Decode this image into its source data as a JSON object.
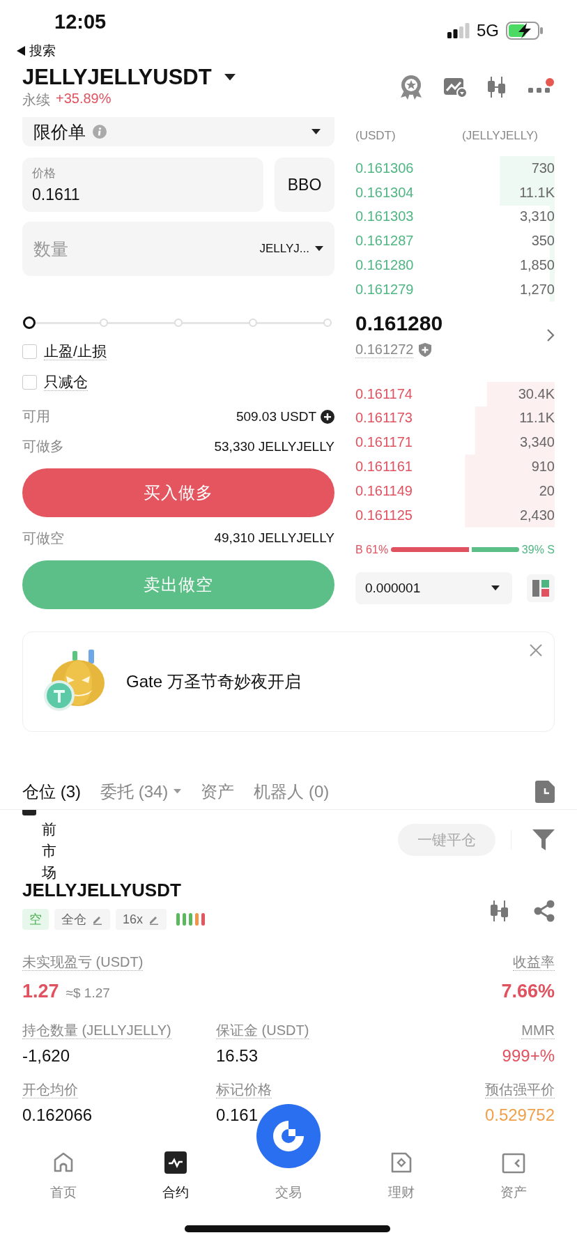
{
  "status_bar": {
    "time": "12:05",
    "network": "5G"
  },
  "back": {
    "label": "搜索"
  },
  "header": {
    "symbol": "JELLYJELLYUSDT",
    "type": "永续",
    "change": "+35.89%"
  },
  "order_form": {
    "order_type": "限价单",
    "price": {
      "label": "价格",
      "value": "0.1611"
    },
    "bbo": "BBO",
    "quantity": {
      "placeholder": "数量",
      "unit": "JELLYJ..."
    },
    "slider": {
      "level": 0
    },
    "options": [
      {
        "label": "止盈/止损",
        "checked": false
      },
      {
        "label": "只减仓",
        "checked": false
      }
    ],
    "available": {
      "label": "可用",
      "value": "509.03 USDT"
    },
    "long_max": {
      "label": "可做多",
      "value": "53,330 JELLYJELLY"
    },
    "buy_button": "买入做多",
    "short_max": {
      "label": "可做空",
      "value": "49,310 JELLYJELLY"
    },
    "sell_button": "卖出做空"
  },
  "order_book": {
    "columns": [
      "(USDT)",
      "(JELLYJELLY)"
    ],
    "asks": [
      {
        "price": "0.161306",
        "amount": "730"
      },
      {
        "price": "0.161304",
        "amount": "11.1K"
      },
      {
        "price": "0.161303",
        "amount": "3,310"
      },
      {
        "price": "0.161287",
        "amount": "350"
      },
      {
        "price": "0.161280",
        "amount": "1,850"
      },
      {
        "price": "0.161279",
        "amount": "1,270"
      }
    ],
    "last_price": "0.161280",
    "mark_price": "0.161272",
    "bids": [
      {
        "price": "0.161174",
        "amount": "30.4K"
      },
      {
        "price": "0.161173",
        "amount": "11.1K"
      },
      {
        "price": "0.161171",
        "amount": "3,340"
      },
      {
        "price": "0.161161",
        "amount": "910"
      },
      {
        "price": "0.161149",
        "amount": "20"
      },
      {
        "price": "0.161125",
        "amount": "2,430"
      }
    ],
    "ratio": {
      "buy": "B 61%",
      "sell": "39% S",
      "level": 0.61
    },
    "precision": "0.000001"
  },
  "banner": {
    "text": "Gate 万圣节奇妙夜开启"
  },
  "tabs": [
    {
      "label": "仓位 (3)",
      "selected": true,
      "dropdown": false
    },
    {
      "label": "委托 (34)",
      "selected": false,
      "dropdown": true
    },
    {
      "label": "资产",
      "selected": false,
      "dropdown": false
    },
    {
      "label": "机器人 (0)",
      "selected": false,
      "dropdown": false
    }
  ],
  "positions": {
    "filter": {
      "label": "前市场",
      "checked": true
    },
    "close_all": "一键平仓",
    "symbol": "JELLYJELLYUSDT",
    "tags": [
      {
        "label": "空",
        "kind": "side"
      },
      {
        "label": "全仓",
        "kind": "editable"
      },
      {
        "label": "16x",
        "kind": "editable"
      }
    ],
    "risk_bars": [
      {
        "color": "#5cb85c"
      },
      {
        "color": "#5cb85c"
      },
      {
        "color": "#5cb85c"
      },
      {
        "color": "#f0954a"
      },
      {
        "color": "#e5575f"
      }
    ],
    "pnl": {
      "label": "未实现盈亏 (USDT)",
      "value": "1.27",
      "approx": "≈$ 1.27"
    },
    "roe": {
      "label": "收益率",
      "value": "7.66%"
    },
    "fields": [
      {
        "label": "持仓数量 (JELLYJELLY)",
        "value": "-1,620",
        "color": "#111111"
      },
      {
        "label": "保证金 (USDT)",
        "value": "16.53",
        "color": "#111111"
      },
      {
        "label": "MMR",
        "value": "999+%",
        "color": "#e0525f"
      },
      {
        "label": "开仓均价",
        "value": "0.162066",
        "color": "#111111"
      },
      {
        "label": "标记价格",
        "value": "0.161",
        "color": "#111111"
      },
      {
        "label": "预估强平价",
        "value": "0.529752",
        "color": "#f0a04b"
      }
    ]
  },
  "nav": [
    {
      "label": "首页",
      "selected": false,
      "kind": "home"
    },
    {
      "label": "合约",
      "selected": true,
      "kind": "futures"
    },
    {
      "label": "交易",
      "selected": false,
      "kind": "trade"
    },
    {
      "label": "理财",
      "selected": false,
      "kind": "earn"
    },
    {
      "label": "资产",
      "selected": false,
      "kind": "assets"
    }
  ]
}
